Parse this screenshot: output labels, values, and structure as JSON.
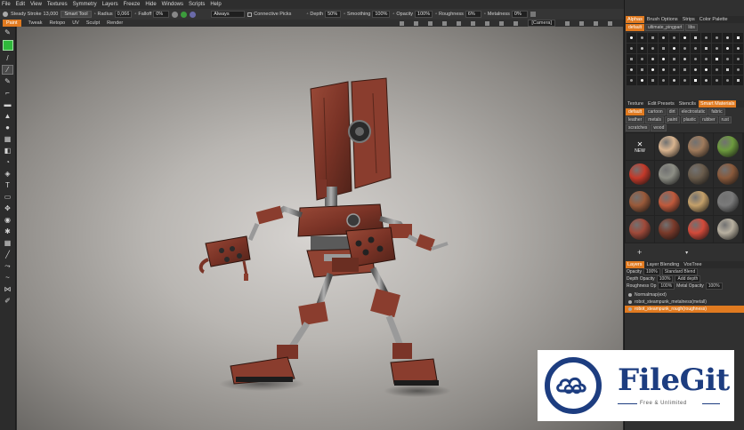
{
  "menu": [
    "File",
    "Edit",
    "View",
    "Textures",
    "Symmetry",
    "Layers",
    "Freeze",
    "Hide",
    "Windows",
    "Scripts",
    "Help"
  ],
  "toolbar": {
    "steady_label": "Steady Stroke",
    "steady_value": "13,000",
    "smart_label": "Smart Tool",
    "radius_label": "Radius",
    "radius_value": "0,066",
    "falloff_label": "Falloff",
    "falloff_value": "0%",
    "always_label": "Always",
    "connective_label": "Connective Picks",
    "depth_label": "Depth",
    "depth_value": "50%",
    "smoothing_label": "Smoothing",
    "smoothing_value": "100%",
    "opacity_label": "Opacity",
    "opacity_value": "100%",
    "roughness_label": "Roughness",
    "roughness_value": "6%",
    "metalness_label": "Metalness",
    "metalness_value": "0%",
    "color_primary": "#2fb83b"
  },
  "modes": [
    "Paint",
    "Tweak",
    "Retopo",
    "UV",
    "Sculpt",
    "Render"
  ],
  "active_mode": "Paint",
  "camera_label": "[Camera]",
  "tools": [
    "brush-icon",
    "pencil-icon",
    "line-icon",
    "pen-icon",
    "airbrush-icon",
    "fill-icon",
    "stamp-icon",
    "clone-icon",
    "gradient-icon",
    "smudge-icon",
    "eraser-icon",
    "text-icon",
    "selection-icon",
    "transform-icon",
    "eye-icon",
    "dropper-icon",
    "grid-icon",
    "ruler-icon",
    "lasso-icon",
    "curve-icon",
    "mirror-icon",
    "measure-icon"
  ],
  "alphas_panel": {
    "tabs": [
      "Alphas",
      "Brush Options",
      "Strips",
      "Color Palette"
    ],
    "active_tab": "Alphas",
    "filters": [
      "default",
      "ultimate_pingpart",
      "libs"
    ]
  },
  "materials_panel": {
    "tabs": [
      "Texture",
      "Edit Presets",
      "Stencils",
      "Smart Materials"
    ],
    "active_tab": "Smart Materials",
    "filters": [
      "default",
      "cartoon",
      "dirt",
      "electrostatic",
      "fabric",
      "leather",
      "metals",
      "paint",
      "plastic",
      "rubber",
      "rust",
      "scratches",
      "wood"
    ],
    "new_label": "NEW",
    "colors": [
      "#2a2a2a",
      "#d9b48f",
      "#a07b5c",
      "#6d9a3e",
      "#c43a2a",
      "#8d8e85",
      "#6a5c4c",
      "#8a5a3c",
      "#9a5a3a",
      "#c05a3c",
      "#c4a06a",
      "#7a7a7a",
      "#a04a3a",
      "#7a3a2a",
      "#d24a3a",
      "#b8b0a0"
    ]
  },
  "layers_panel": {
    "tabs": [
      "Layers",
      "Layer Blending",
      "VoxTree"
    ],
    "active_tab": "Layers",
    "opacity_label": "Opacity",
    "opacity_value": "100%",
    "blend_value": "Standard Blend",
    "depth_opacity_label": "Depth Opacity",
    "depth_opacity_value": "100%",
    "depth_blend_value": "Add depth",
    "roughness_opacity_label": "Roughness Op",
    "roughness_opacity_value": "100%",
    "metal_opacity_label": "Metal Opacity",
    "metal_opacity_value": "100%",
    "layers": [
      {
        "name": "Normalmap(ext)",
        "active": false
      },
      {
        "name": "robot_steampunk_metalness(metall)",
        "active": false
      },
      {
        "name": "robot_steampunk_rough(roughness)",
        "active": true
      }
    ]
  },
  "watermark": {
    "title": "FileGit",
    "subtitle": "Free & Unlimited"
  }
}
